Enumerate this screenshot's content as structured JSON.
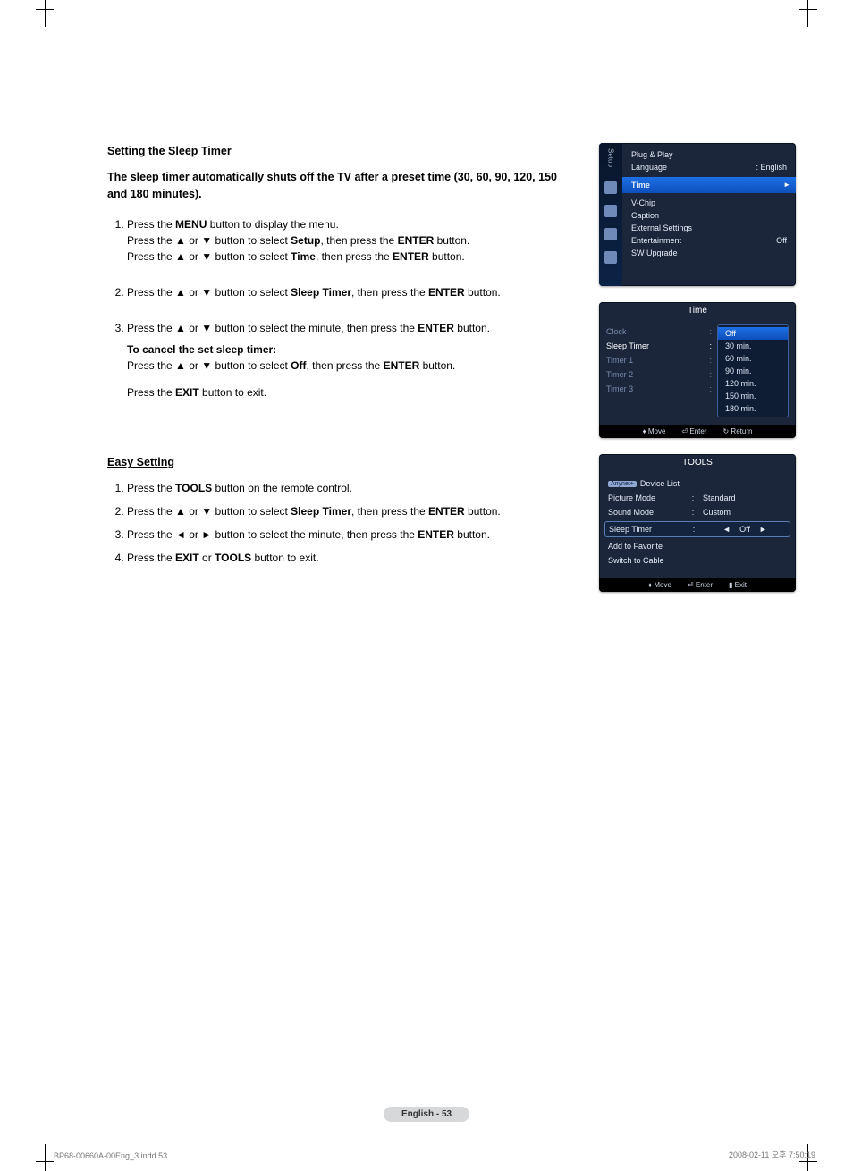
{
  "title": "Setting the Sleep Timer",
  "lead": "The sleep timer automatically shuts off the TV after a preset time (30, 60, 90, 120, 150 and 180 minutes).",
  "steps": {
    "s1a": "Press the ",
    "s1a_menu": "MENU",
    "s1a_tail": " button to display the menu.",
    "s1b_pre": "Press the ▲ or ▼ button to select ",
    "s1b_setup": "Setup",
    "s1b_mid": ", then press the ",
    "s1b_enter": "ENTER",
    "s1b_tail": " button.",
    "s1c_pre": "Press the ▲ or ▼ button to select ",
    "s1c_time": "Time",
    "s1c_mid": ", then press the ",
    "s1c_enter": "ENTER",
    "s1c_tail": " button.",
    "s2_pre": "Press the ▲ or ▼ button to select ",
    "s2_st": "Sleep Timer",
    "s2_mid": ", then press the ",
    "s2_enter": "ENTER",
    "s2_tail": " button.",
    "s3a_pre": "Press the ▲ or ▼ button to select the minute, then press the ",
    "s3a_enter": "ENTER",
    "s3a_tail": " button.",
    "s3_cancel_title": "To cancel the set sleep timer:",
    "s3b_pre": "Press the ▲ or ▼ button to select ",
    "s3b_off": "Off",
    "s3b_mid": ", then press the ",
    "s3b_enter": "ENTER",
    "s3b_tail": " button.",
    "s3c_pre": "Press the ",
    "s3c_exit": "EXIT",
    "s3c_tail": " button to exit."
  },
  "easy_title": "Easy Setting",
  "easy": {
    "e1_pre": "Press the ",
    "e1_tools": "TOOLS",
    "e1_tail": " button on the remote control.",
    "e2_pre": "Press the ▲ or ▼ button to select ",
    "e2_st": "Sleep Timer",
    "e2_mid": ", then press the ",
    "e2_enter": "ENTER",
    "e2_tail": " button.",
    "e3_pre": "Press the ◄ or ► button to select the minute, then press the ",
    "e3_enter": "ENTER",
    "e3_tail": " button.",
    "e4_pre": "Press the ",
    "e4_exit": "EXIT",
    "e4_mid": " or ",
    "e4_tools": "TOOLS",
    "e4_tail": " button to exit."
  },
  "osd_setup": {
    "side_label": "Setup",
    "items": [
      "Plug & Play",
      "Language",
      "Time",
      "V-Chip",
      "Caption",
      "External Settings",
      "Entertainment",
      "SW Upgrade"
    ],
    "lang_val": ": English",
    "ent_val": ": Off"
  },
  "osd_time": {
    "title": "Time",
    "left_rows": [
      "Clock",
      "Sleep Timer",
      "Timer 1",
      "Timer 2",
      "Timer 3"
    ],
    "options": [
      "Off",
      "30 min.",
      "60 min.",
      "90 min.",
      "120 min.",
      "150 min.",
      "180 min."
    ],
    "foot": {
      "move": "Move",
      "enter": "Enter",
      "return": "Return"
    }
  },
  "osd_tools": {
    "title": "TOOLS",
    "rows": {
      "device": "Device List",
      "picture": "Picture Mode",
      "picture_val": "Standard",
      "sound": "Sound Mode",
      "sound_val": "Custom",
      "sleep": "Sleep Timer",
      "sleep_val": "Off",
      "fav": "Add to Favorite",
      "cable": "Switch to Cable"
    },
    "foot": {
      "move": "Move",
      "enter": "Enter",
      "exit": "Exit"
    }
  },
  "page_badge": "English - 53",
  "foot_left": "BP68-00660A-00Eng_3.indd   53",
  "foot_right": "2008-02-11   오후 7:50:19"
}
